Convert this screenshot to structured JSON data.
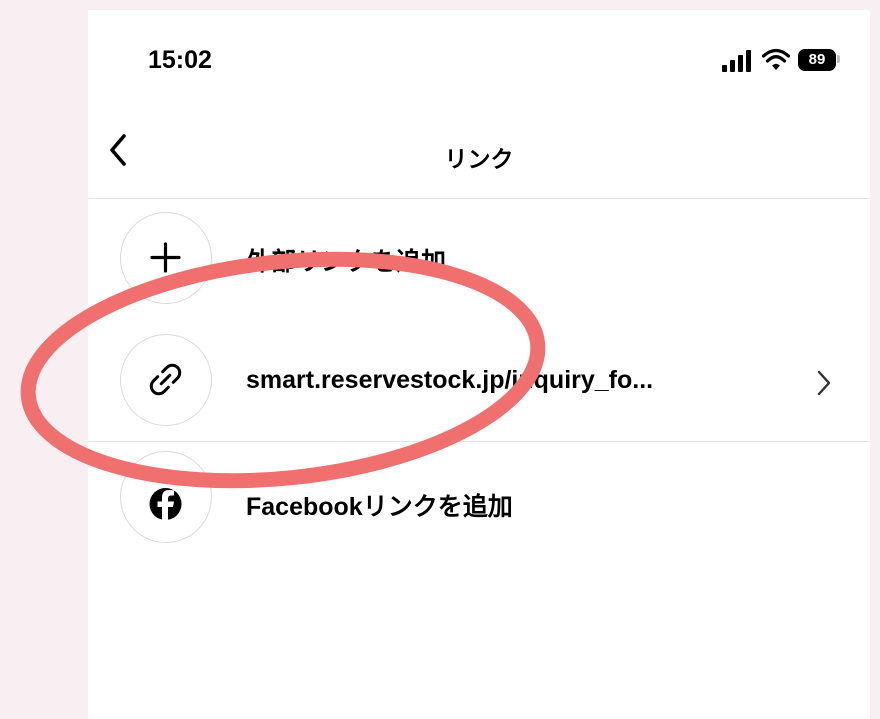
{
  "status_bar": {
    "time": "15:02",
    "battery": "89",
    "icons": [
      "signal-icon",
      "wifi-icon",
      "battery-icon"
    ]
  },
  "header": {
    "back_icon": "chevron-left-icon",
    "title": "リンク"
  },
  "links": [
    {
      "icon": "plus-icon",
      "label": "外部リンクを追加"
    },
    {
      "icon": "link-icon",
      "label": "smart.reservestock.jp/inquiry_fo...",
      "chevron_icon": "chevron-right-icon"
    },
    {
      "icon": "facebook-icon",
      "label": "Facebookリンクを追加"
    }
  ],
  "annotation": {
    "shape": "ellipse",
    "color": "#f07070"
  },
  "colors": {
    "page_background": "#f7eff1",
    "screen_background": "#ffffff",
    "divider": "#e4e4e4",
    "icon_circle_border": "#d9d9d9"
  }
}
